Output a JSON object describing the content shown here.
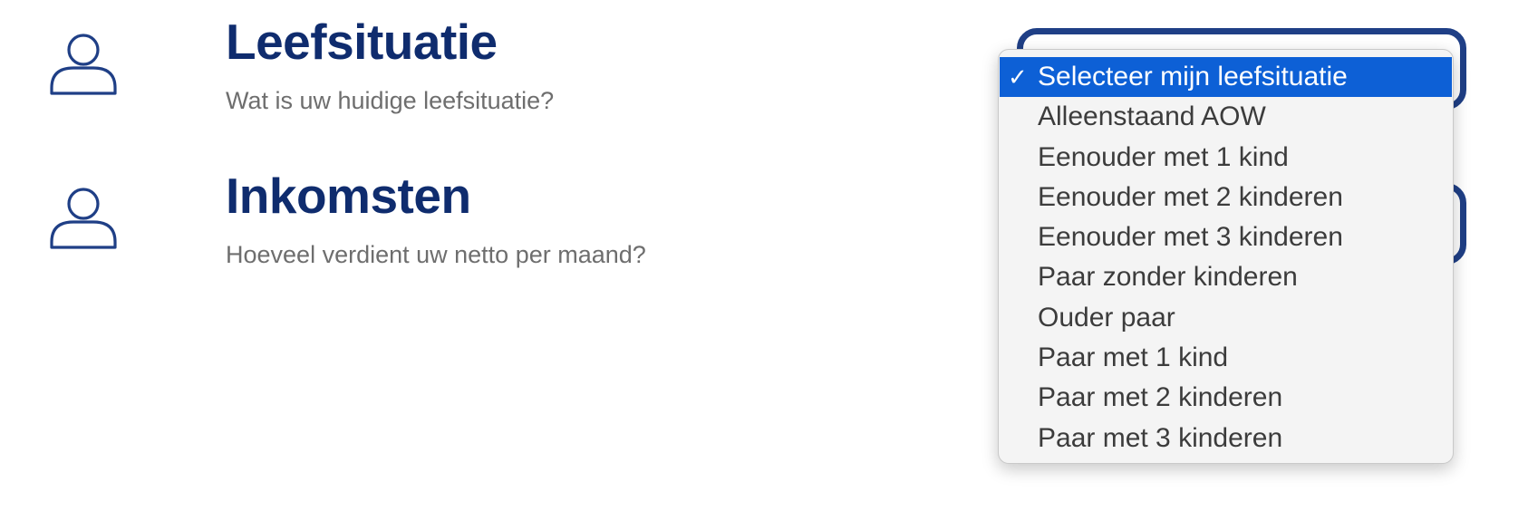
{
  "rows": [
    {
      "title": "Leefsituatie",
      "question": "Wat is uw huidige leefsituatie?",
      "icon": "user-icon"
    },
    {
      "title": "Inkomsten",
      "question": "Hoeveel verdient uw netto per maand?",
      "icon": "user-icon"
    }
  ],
  "dropdown": {
    "selected_index": 0,
    "check_glyph": "✓",
    "options": [
      "Selecteer mijn leefsituatie",
      "Alleenstaand AOW",
      "Eenouder met 1 kind",
      "Eenouder met 2 kinderen",
      "Eenouder met 3 kinderen",
      "Paar zonder kinderen",
      "Ouder paar",
      "Paar met 1 kind",
      "Paar met 2 kinderen",
      "Paar met 3 kinderen"
    ]
  },
  "colors": {
    "title": "#0f2c6e",
    "question": "#6e6e6e",
    "icon": "#1f3f86",
    "select_border": "#1f3f86",
    "highlight": "#0d60d6"
  }
}
